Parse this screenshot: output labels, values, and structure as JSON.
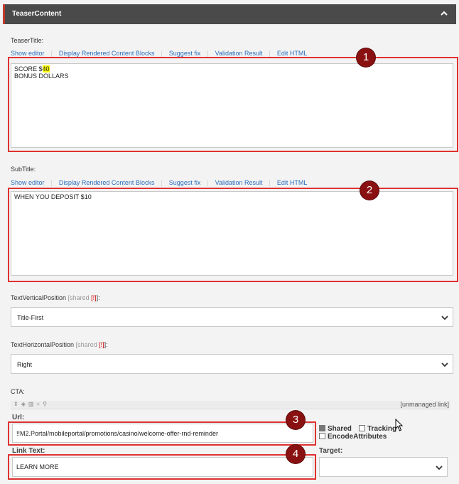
{
  "panel": {
    "title": "TeaserContent"
  },
  "editor_toolbar": [
    "Show editor",
    "Display Rendered Content Blocks",
    "Suggest fix",
    "Validation Result",
    "Edit HTML"
  ],
  "teaser_title": {
    "label": "TeaserTitle:",
    "line1_prefix": "SCORE $",
    "line1_highlight": "40",
    "line2": "BONUS DOLLARS"
  },
  "subtitle": {
    "label": "SubTitle:",
    "value": "WHEN YOU DEPOSIT $10"
  },
  "text_vertical_position": {
    "label": "TextVerticalPosition",
    "shared": "[shared",
    "flag": "[!]",
    "close": "]:",
    "value": "Title-First"
  },
  "text_horizontal_position": {
    "label": "TextHorizontalPosition",
    "shared": "[shared",
    "flag": "[!]",
    "close": "]:",
    "value": "Right"
  },
  "cta": {
    "label": "CTA:",
    "unmanaged": "[unmanaged link]",
    "url_label": "Url:",
    "url_value": "!!M2.Portal/mobileportal/promotions/casino/welcome-offer-rnd-reminder",
    "shared_label": "Shared",
    "tracking_label": "Tracking",
    "encode_label": "EncodeAttributes",
    "link_text_label": "Link Text:",
    "link_text_value": "LEARN MORE",
    "target_label": "Target:",
    "target_value": ""
  },
  "annotations": [
    "1",
    "2",
    "3",
    "4"
  ],
  "colors": {
    "annotation_border": "#e03131",
    "badge": "#8a1111",
    "link": "#2a6ebb",
    "header": "#4a4a4a",
    "highlight": "#ffff00"
  }
}
